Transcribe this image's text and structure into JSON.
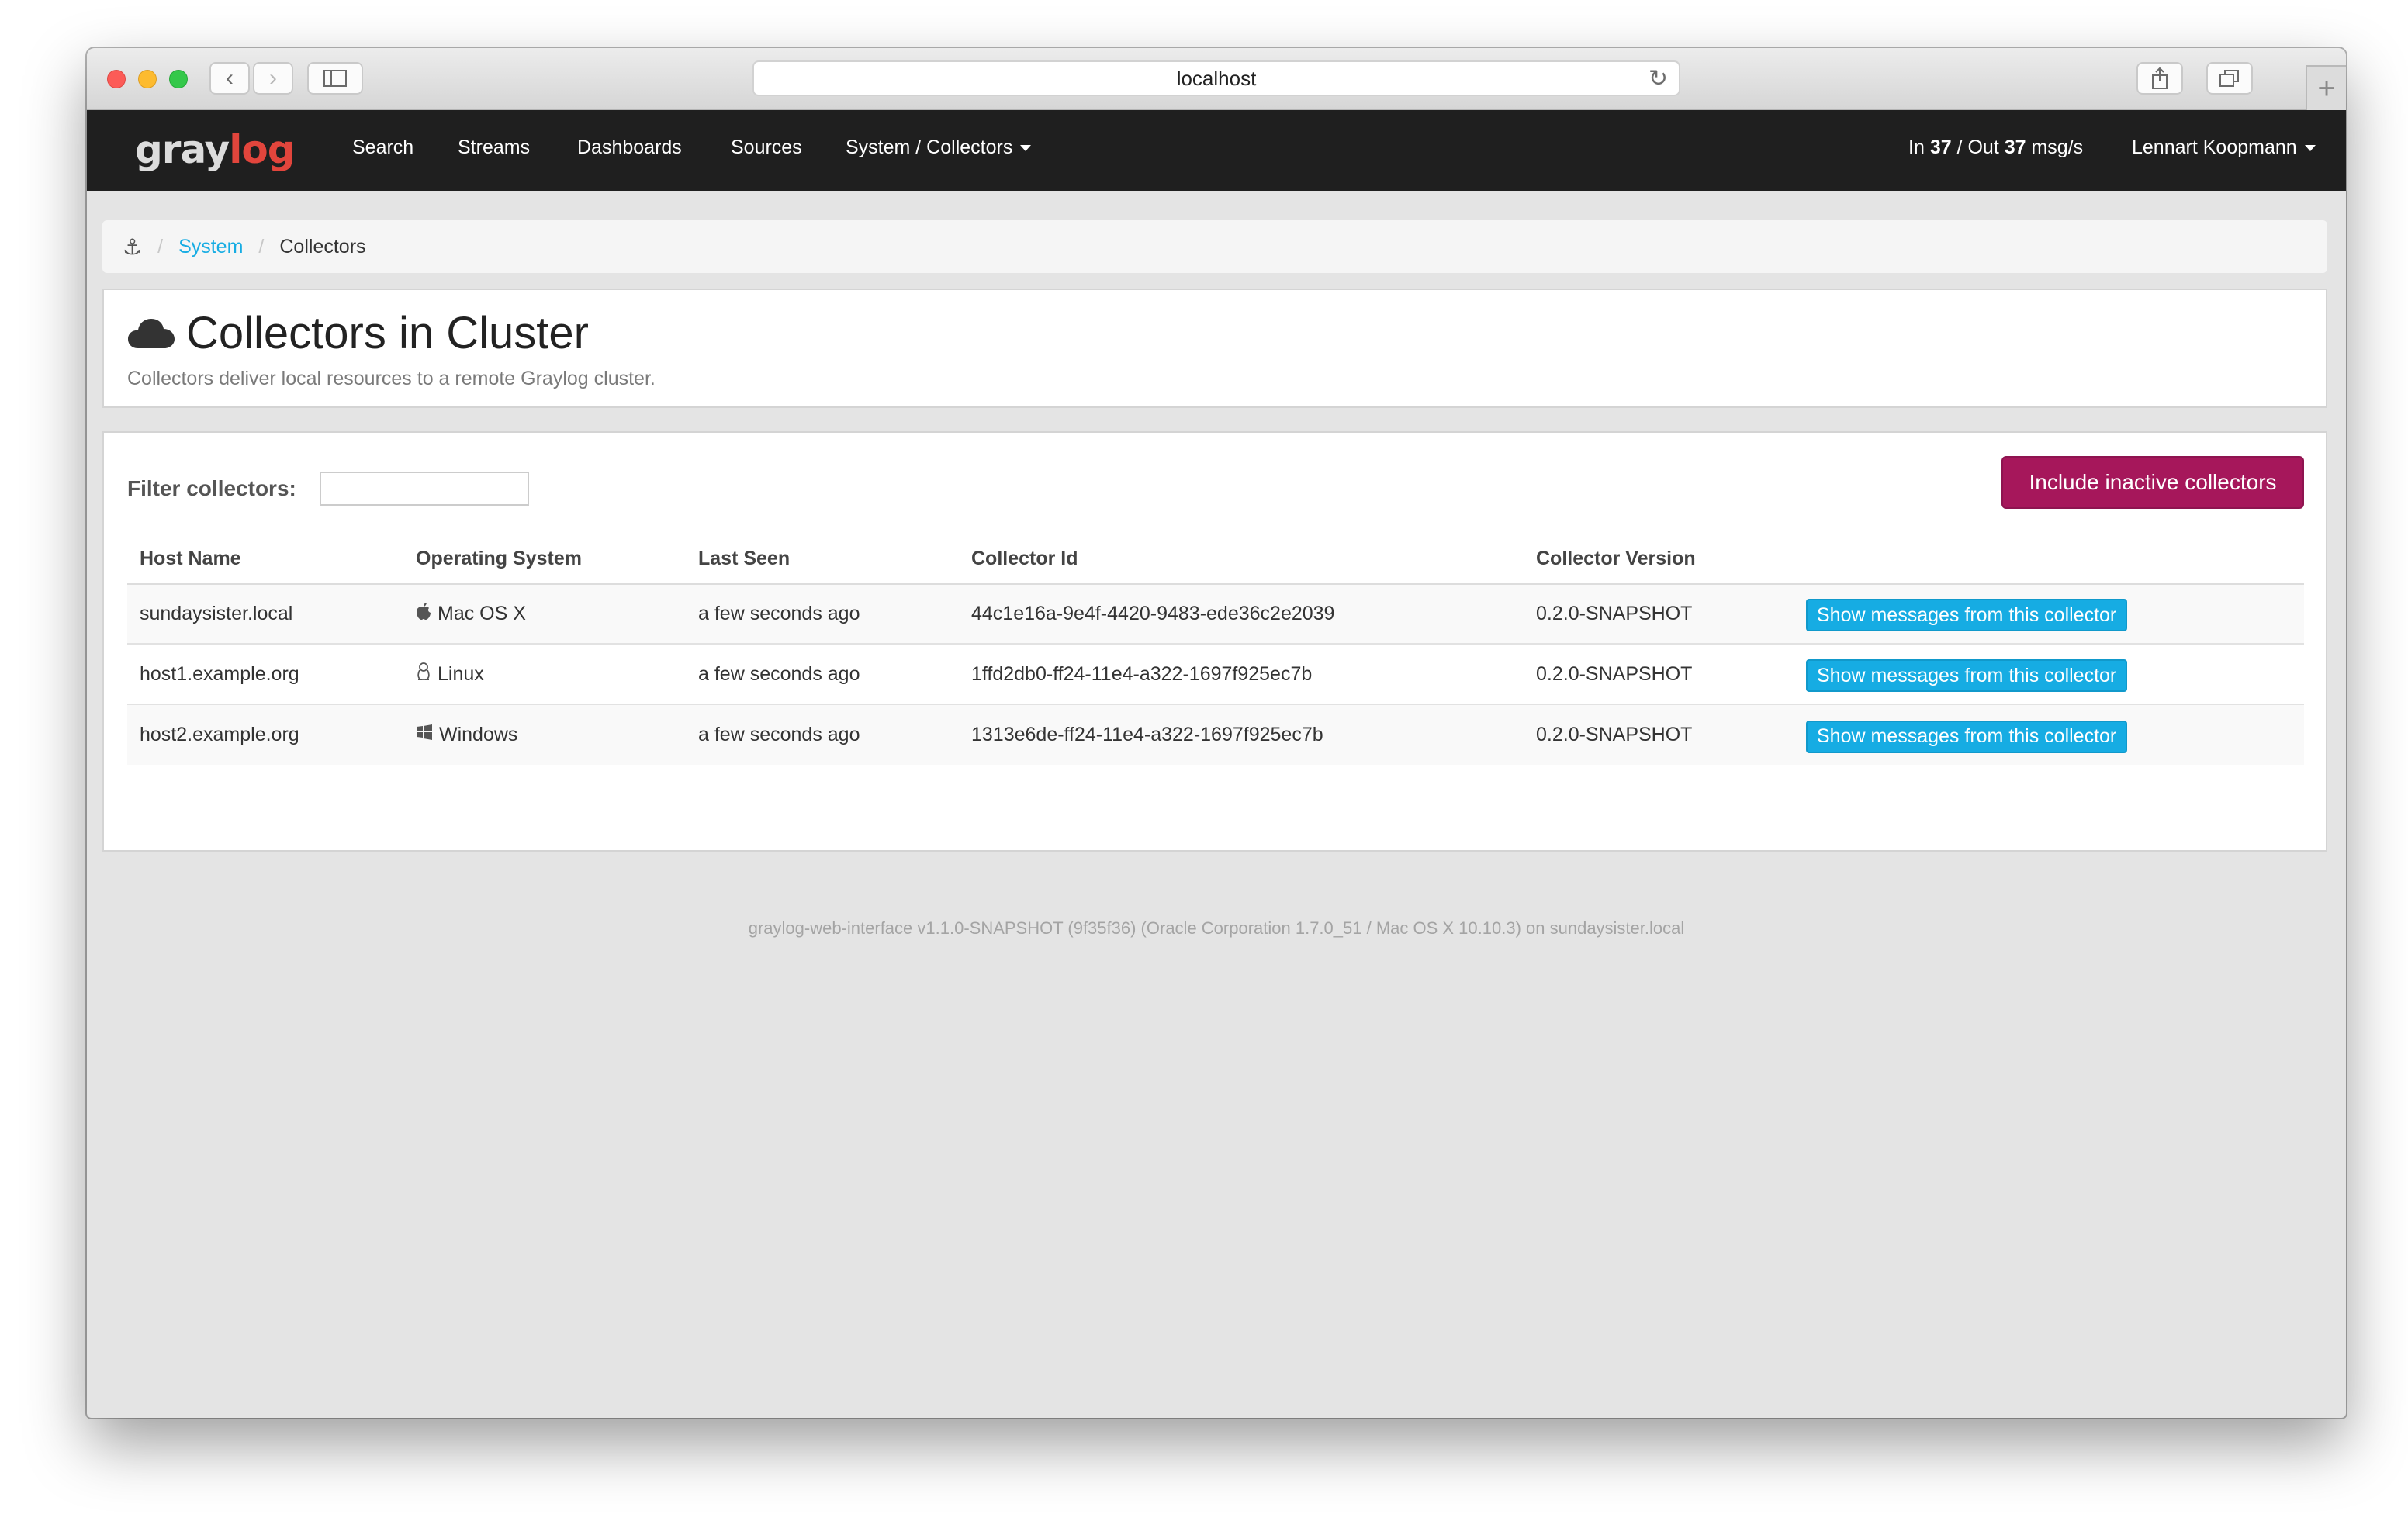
{
  "browser": {
    "url": "localhost",
    "back_icon": "chevron-left-icon",
    "forward_icon": "chevron-right-icon",
    "sidebar_icon": "sidebar-icon",
    "reload_icon": "reload-icon",
    "share_icon": "share-icon",
    "tabs_icon": "tabs-icon",
    "new_tab_icon": "plus-icon"
  },
  "navbar": {
    "logo_gray": "gray",
    "logo_log": "log",
    "items": [
      {
        "label": "Search"
      },
      {
        "label": "Streams"
      },
      {
        "label": "Dashboards"
      },
      {
        "label": "Sources"
      },
      {
        "label": "System / Collectors"
      }
    ],
    "throughput": {
      "in_label": "In",
      "in_value": "37",
      "separator": "/ Out",
      "out_value": "37",
      "unit": "msg/s"
    },
    "user": "Lennart Koopmann"
  },
  "breadcrumb": {
    "home_icon": "anchor-icon",
    "items": [
      "System",
      "Collectors"
    ]
  },
  "header": {
    "icon": "cloud-icon",
    "title": "Collectors in Cluster",
    "subtitle": "Collectors deliver local resources to a remote Graylog cluster."
  },
  "filter": {
    "label": "Filter collectors:",
    "value": "",
    "placeholder": ""
  },
  "inactive_button": "Include inactive collectors",
  "table": {
    "columns": [
      "Host Name",
      "Operating System",
      "Last Seen",
      "Collector Id",
      "Collector Version",
      ""
    ],
    "rows": [
      {
        "host": "sundaysister.local",
        "os": "Mac OS X",
        "os_icon": "apple-icon",
        "last_seen": "a few seconds ago",
        "id": "44c1e16a-9e4f-4420-9483-ede36c2e2039",
        "version": "0.2.0-SNAPSHOT",
        "action": "Show messages from this collector"
      },
      {
        "host": "host1.example.org",
        "os": "Linux",
        "os_icon": "linux-icon",
        "last_seen": "a few seconds ago",
        "id": "1ffd2db0-ff24-11e4-a322-1697f925ec7b",
        "version": "0.2.0-SNAPSHOT",
        "action": "Show messages from this collector"
      },
      {
        "host": "host2.example.org",
        "os": "Windows",
        "os_icon": "windows-icon",
        "last_seen": "a few seconds ago",
        "id": "1313e6de-ff24-11e4-a322-1697f925ec7b",
        "version": "0.2.0-SNAPSHOT",
        "action": "Show messages from this collector"
      }
    ]
  },
  "footer": "graylog-web-interface v1.1.0-SNAPSHOT (9f35f36) (Oracle Corporation 1.7.0_51 / Mac OS X 10.10.3) on sundaysister.local",
  "colors": {
    "navbar": "#1f1f1f",
    "accent_button": "#a6175b",
    "link": "#16ace3"
  }
}
